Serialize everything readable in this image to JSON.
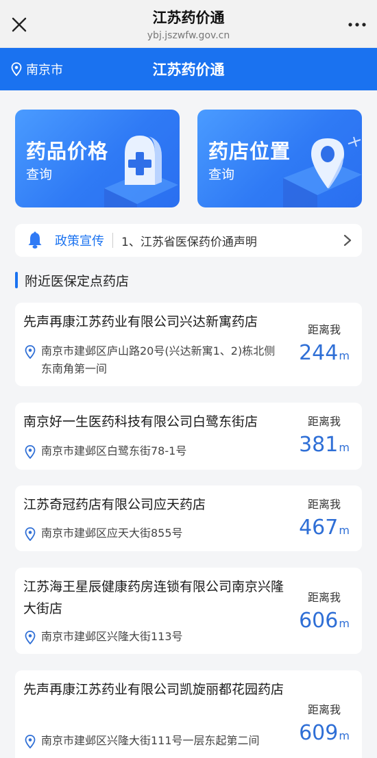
{
  "browser": {
    "title": "江苏药价通",
    "url": "ybj.jszwfw.gov.cn"
  },
  "header": {
    "city": "南京市",
    "title": "江苏药价通"
  },
  "features": [
    {
      "title": "药品价格",
      "subtitle": "查询"
    },
    {
      "title": "药店位置",
      "subtitle": "查询"
    }
  ],
  "notice": {
    "tag": "政策宣传",
    "text": "1、江苏省医保药价通声明"
  },
  "section_title": "附近医保定点药店",
  "stores": [
    {
      "name": "先声再康江苏药业有限公司兴达新寓药店",
      "address": "南京市建邺区庐山路20号(兴达新寓1、2)栋北侧东南角第一间",
      "distance_label": "距离我",
      "distance": "244",
      "unit": "m"
    },
    {
      "name": "南京好一生医药科技有限公司白鹭东街店",
      "address": "南京市建邺区白鹭东街78-1号",
      "distance_label": "距离我",
      "distance": "381",
      "unit": "m"
    },
    {
      "name": "江苏奇冠药店有限公司应天药店",
      "address": "南京市建邺区应天大街855号",
      "distance_label": "距离我",
      "distance": "467",
      "unit": "m"
    },
    {
      "name": "江苏海王星辰健康药房连锁有限公司南京兴隆大街店",
      "address": "南京市建邺区兴隆大街113号",
      "distance_label": "距离我",
      "distance": "606",
      "unit": "m"
    },
    {
      "name": "先声再康江苏药业有限公司凯旋丽都花园药店",
      "address": "南京市建邺区兴隆大街111号一层东起第二间",
      "distance_label": "距离我",
      "distance": "609",
      "unit": "m"
    }
  ],
  "colors": {
    "accent": "#1a72f0",
    "distance": "#2f6fd6",
    "background": "#f4f5f7"
  }
}
